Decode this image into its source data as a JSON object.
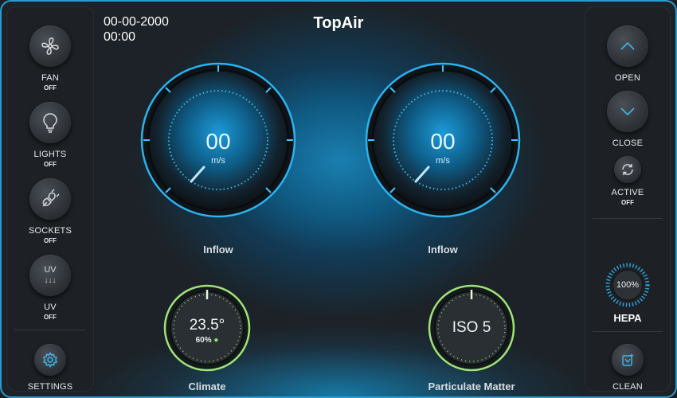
{
  "app": {
    "title": "TopAir",
    "date": "00-00-2000",
    "time": "00:00"
  },
  "left_sidebar": {
    "fan": {
      "label": "FAN",
      "state": "OFF"
    },
    "lights": {
      "label": "LIGHTS",
      "state": "OFF"
    },
    "sockets": {
      "label": "SOCKETS",
      "state": "OFF"
    },
    "uv": {
      "label": "UV",
      "state": "OFF",
      "icon_text": "UV",
      "icon_arrows": "↓↓↓"
    },
    "settings": {
      "label": "SETTINGS"
    }
  },
  "right_sidebar": {
    "open": {
      "label": "OPEN"
    },
    "close": {
      "label": "CLOSE"
    },
    "active": {
      "label": "ACTIVE",
      "state": "OFF"
    },
    "hepa": {
      "label": "HEPA",
      "value": "100%",
      "level": 1.0
    },
    "clean": {
      "label": "CLEAN"
    }
  },
  "gauges": {
    "inflow_left": {
      "value": "00",
      "unit": "m/s",
      "label": "Inflow"
    },
    "inflow_right": {
      "value": "00",
      "unit": "m/s",
      "label": "Inflow"
    },
    "climate": {
      "temperature": "23.5°",
      "humidity": "60%",
      "label": "Climate"
    },
    "particulate": {
      "value": "ISO 5",
      "label": "Particulate Matter"
    }
  },
  "colors": {
    "accent": "#2aa7e0",
    "cyan": "#4fd0ff",
    "green": "#8fe06a",
    "panel": "#1d2024"
  }
}
